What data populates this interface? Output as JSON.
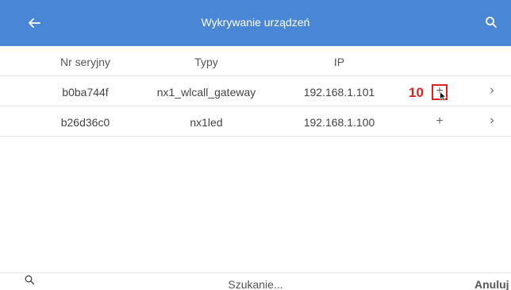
{
  "appbar": {
    "title": "Wykrywanie urządzeń",
    "back_icon": "arrow-left-icon",
    "search_icon": "search-icon",
    "color": "#4a86d6"
  },
  "table": {
    "columns": [
      "Nr seryjny",
      "Typy",
      "IP"
    ],
    "rows": [
      {
        "serial": "b0ba744f",
        "type": "nx1_wlcall_gateway",
        "ip": "192.168.1.101",
        "add": "+",
        "chevron": "›"
      },
      {
        "serial": "b26d36c0",
        "type": "nx1led",
        "ip": "192.168.1.100",
        "add": "+",
        "chevron": "›"
      }
    ]
  },
  "annotation": {
    "step": "10",
    "color": "#e02020"
  },
  "bottombar": {
    "search_icon": "search-icon",
    "placeholder": "Szukanie...",
    "cancel_label": "Anuluj"
  }
}
